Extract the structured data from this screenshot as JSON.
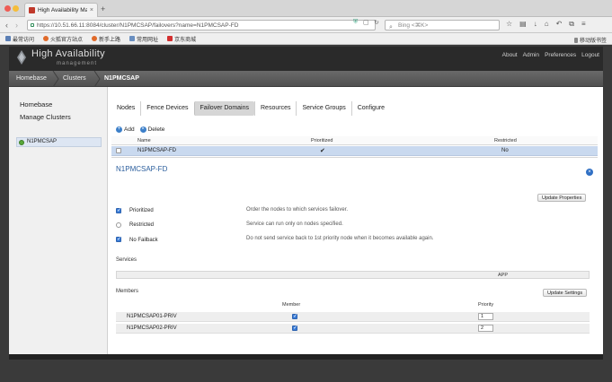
{
  "browser": {
    "tab_title": "High Availability Managem...",
    "url": "https://10.51.66.11:8084/cluster/N1PMCSAP/failovers?name=N1PMCSAP-FD",
    "search_placeholder": "Bing <⌘K>",
    "bookmarks": [
      "最常访问",
      "火狐官方站点",
      "新手上路",
      "常用网址",
      "京东商城"
    ],
    "bookmark_colors": [
      "#5b7fb5",
      "#e06a2a",
      "#e06a2a",
      "#6a8fc0",
      "#d32f2f"
    ],
    "mobile_bookmarks": "移动版书签"
  },
  "app": {
    "brand_title": "High Availability",
    "brand_subtitle": "management",
    "top_nav": [
      "About",
      "Admin",
      "Preferences",
      "Logout"
    ]
  },
  "breadcrumb": {
    "items": [
      "Homebase",
      "Clusters",
      "N1PMCSAP"
    ]
  },
  "sidebar": {
    "links": [
      "Homebase",
      "Manage Clusters"
    ],
    "cluster": "N1PMCSAP",
    "cluster_status_color": "#58a83a"
  },
  "tabs": [
    "Nodes",
    "Fence Devices",
    "Failover Domains",
    "Resources",
    "Service Groups",
    "Configure"
  ],
  "active_tab": "Failover Domains",
  "actions": {
    "add": "Add",
    "delete": "Delete"
  },
  "table": {
    "columns": [
      "Name",
      "Prioritized",
      "Restricted"
    ],
    "rows": [
      {
        "name": "N1PMCSAP-FD",
        "prioritized": "✔",
        "restricted": "No"
      }
    ]
  },
  "detail": {
    "title": "N1PMCSAP-FD",
    "update_properties": "Update Properties",
    "properties": [
      {
        "label": "Prioritized",
        "checked": true,
        "description": "Order the nodes to which services failover."
      },
      {
        "label": "Restricted",
        "checked": false,
        "description": "Service can run only on nodes specified."
      },
      {
        "label": "No Failback",
        "checked": true,
        "description": "Do not send service back to 1st priority node when it becomes available again."
      }
    ],
    "services_label": "Services",
    "services": [
      "APP"
    ],
    "members_label": "Members",
    "update_settings": "Update Settings",
    "member_columns": [
      "Member",
      "Priority"
    ],
    "members": [
      {
        "name": "N1PMCSAP01-PRIV",
        "member": true,
        "priority": "1"
      },
      {
        "name": "N1PMCSAP02-PRIV",
        "member": true,
        "priority": "2"
      }
    ]
  }
}
